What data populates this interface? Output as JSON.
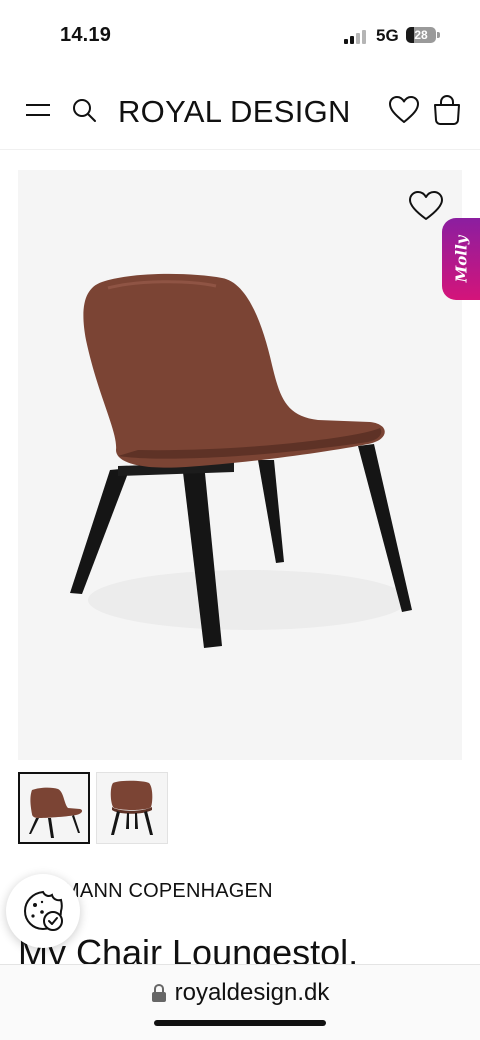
{
  "status": {
    "time": "14.19",
    "network": "5G",
    "battery": "28",
    "battery_level": 0.28
  },
  "header": {
    "logo": "ROYAL DESIGN",
    "icons": [
      "hamburger-menu-icon",
      "search-icon",
      "heart-icon",
      "shopping-bag-icon"
    ]
  },
  "product": {
    "brand": "NORMANN COPENHAGEN",
    "title": "My Chair Loungestol,",
    "widget_label": "Molly",
    "thumbnails": [
      "chair-front-view",
      "chair-back-view"
    ],
    "colors": {
      "seat": "#7b4434",
      "legs": "#151515",
      "background": "#f5f5f5"
    }
  },
  "browser": {
    "url": "royaldesign.dk"
  },
  "colors": {
    "molly_gradient": [
      "#8b1ea0",
      "#d4147a"
    ]
  }
}
